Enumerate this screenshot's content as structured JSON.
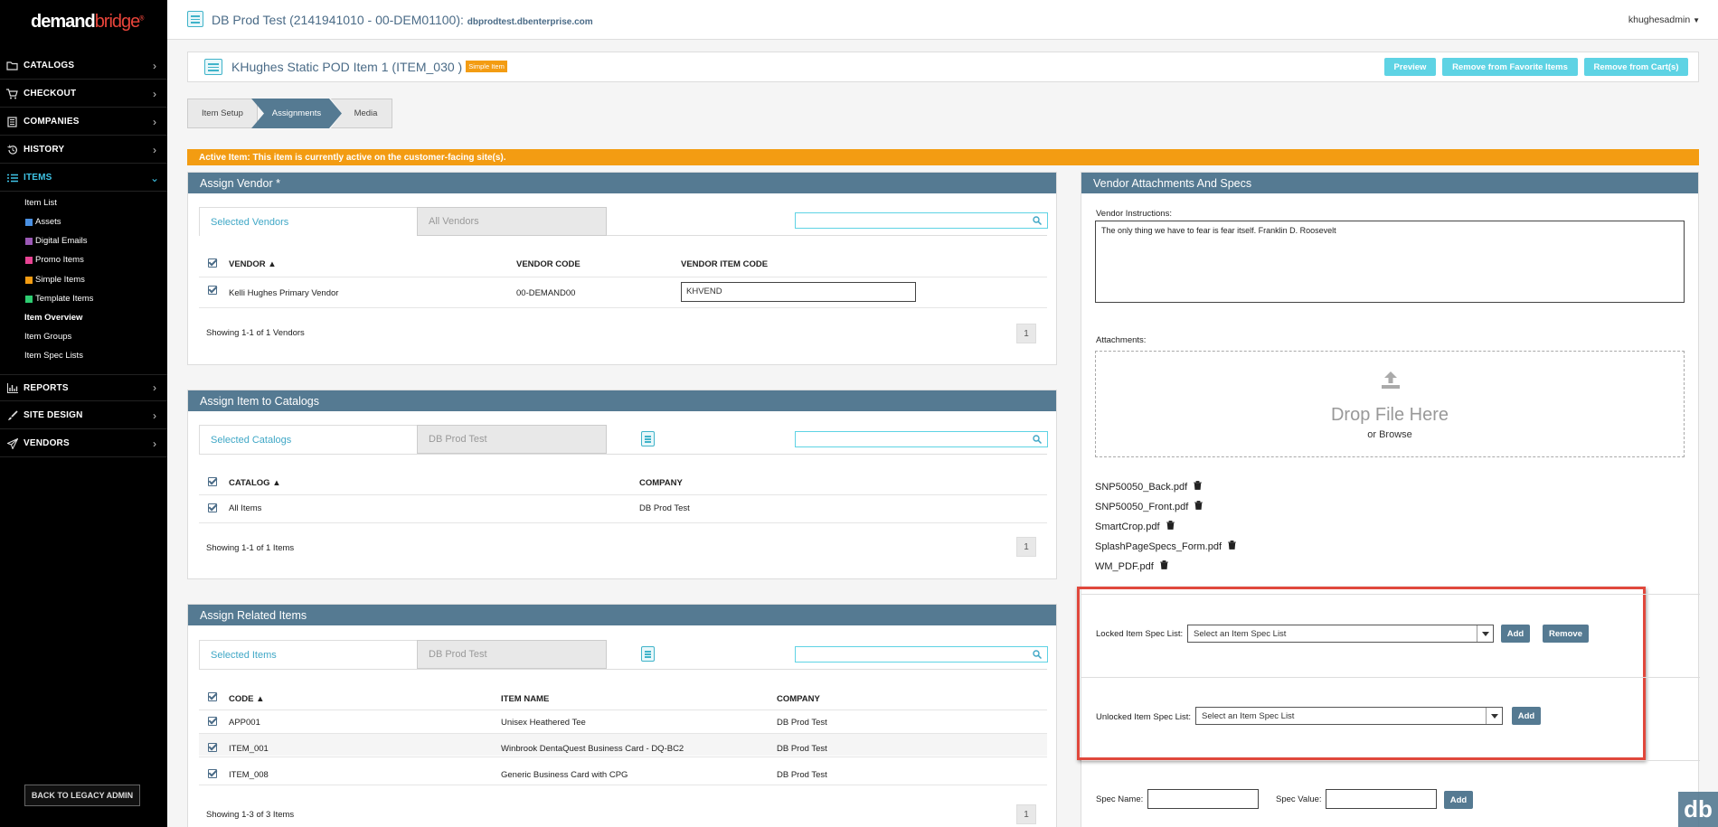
{
  "sidebar": {
    "logo_main": "demand",
    "logo_accent": "bridge",
    "logo_mark": "®",
    "nav": [
      {
        "label": "CATALOGS",
        "icon": "folder-icon"
      },
      {
        "label": "CHECKOUT",
        "icon": "cart-icon"
      },
      {
        "label": "COMPANIES",
        "icon": "building-icon"
      },
      {
        "label": "HISTORY",
        "icon": "history-icon"
      },
      {
        "label": "ITEMS",
        "icon": "list-icon"
      },
      {
        "label": "REPORTS",
        "icon": "bar-chart-icon"
      },
      {
        "label": "SITE DESIGN",
        "icon": "brush-icon"
      },
      {
        "label": "VENDORS",
        "icon": "send-icon"
      }
    ],
    "items_sub": [
      {
        "label": "Item List"
      },
      {
        "label": "Assets",
        "color": "#4a90e2"
      },
      {
        "label": "Digital Emails",
        "color": "#9b59b6"
      },
      {
        "label": "Promo Items",
        "color": "#e84393"
      },
      {
        "label": "Simple Items",
        "color": "#f39c12"
      },
      {
        "label": "Template Items",
        "color": "#2ecc71"
      },
      {
        "label": "Item Overview"
      },
      {
        "label": "Item Groups"
      },
      {
        "label": "Item Spec Lists"
      }
    ],
    "legacy_button": "BACK TO LEGACY ADMIN"
  },
  "header": {
    "site_title": "DB Prod Test (2141941010 - 00-DEM01100):",
    "site_url": "dbprodtest.dbenterprise.com",
    "user": "khughesadmin"
  },
  "item": {
    "title": "KHughes Static POD Item 1 (ITEM_030 )",
    "badge": "Simple Item",
    "buttons": {
      "preview": "Preview",
      "remove_fav": "Remove from Favorite Items",
      "remove_cart": "Remove from Cart(s)"
    }
  },
  "breadcrumbs": [
    "Item Setup",
    "Assignments",
    "Media"
  ],
  "active_banner": "Active Item: This item is currently active on the customer-facing site(s).",
  "vendor_panel": {
    "title": "Assign Vendor *",
    "tab_selected": "Selected Vendors",
    "tab_all": "All Vendors",
    "columns": [
      "VENDOR",
      "VENDOR CODE",
      "VENDOR ITEM CODE"
    ],
    "rows": [
      {
        "vendor": "Kelli Hughes Primary Vendor",
        "code": "00-DEMAND00",
        "item_code": "KHVEND"
      }
    ],
    "showing": "Showing 1-1 of 1 Vendors",
    "page": "1"
  },
  "catalog_panel": {
    "title": "Assign Item to Catalogs",
    "tab_selected": "Selected Catalogs",
    "tab_other": "DB Prod Test",
    "columns": [
      "CATALOG",
      "COMPANY"
    ],
    "rows": [
      {
        "catalog": "All Items",
        "company": "DB Prod Test"
      }
    ],
    "showing": "Showing 1-1 of 1 Items",
    "page": "1"
  },
  "related_panel": {
    "title": "Assign Related Items",
    "tab_selected": "Selected Items",
    "tab_other": "DB Prod Test",
    "columns": [
      "CODE",
      "ITEM NAME",
      "COMPANY"
    ],
    "rows": [
      {
        "code": "APP001",
        "name": "Unisex Heathered Tee",
        "company": "DB Prod Test"
      },
      {
        "code": "ITEM_001",
        "name": "Winbrook DentaQuest Business Card - DQ-BC2",
        "company": "DB Prod Test"
      },
      {
        "code": "ITEM_008",
        "name": "Generic Business Card with CPG",
        "company": "DB Prod Test"
      }
    ],
    "showing": "Showing 1-3 of 3 Items",
    "page": "1"
  },
  "vendor_specs": {
    "title": "Vendor Attachments And Specs",
    "instructions_label": "Vendor Instructions:",
    "instructions_value": "The only thing we have to fear is fear itself. Franklin D. Roosevelt",
    "attachments_label": "Attachments:",
    "drop_text": "Drop File Here",
    "browse_text": "or Browse",
    "files": [
      "SNP50050_Back.pdf",
      "SNP50050_Front.pdf",
      "SmartCrop.pdf",
      "SplashPageSpecs_Form.pdf",
      "WM_PDF.pdf"
    ],
    "locked_label": "Locked Item Spec List:",
    "locked_select": "Select an Item Spec List",
    "unlocked_label": "Unlocked Item Spec List:",
    "unlocked_select": "Select an Item Spec List",
    "add": "Add",
    "remove": "Remove",
    "spec_name_label": "Spec Name:",
    "spec_value_label": "Spec Value:",
    "spec_add": "Add"
  },
  "corner_logo": "db",
  "colors": {
    "accent": "#3fc4e6",
    "header": "#557a92",
    "warning": "#f39c12",
    "highlight": "#e0483c"
  }
}
